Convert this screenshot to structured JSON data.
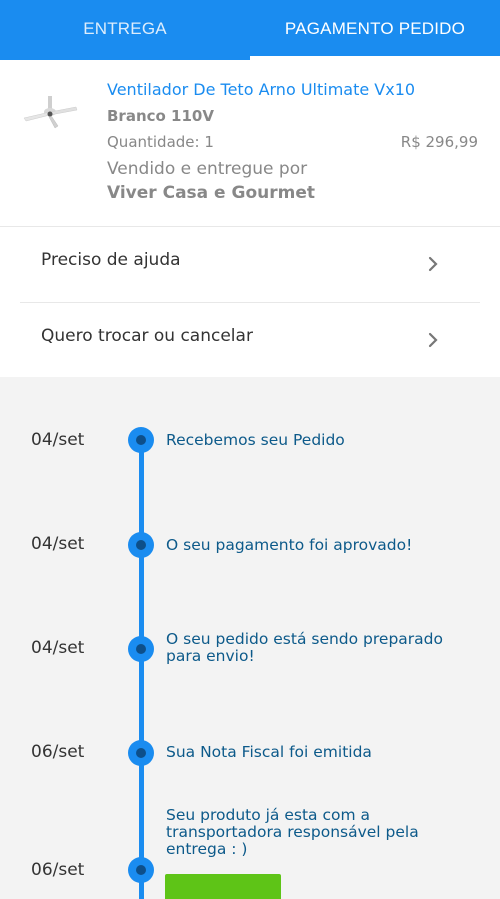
{
  "tabs": [
    {
      "label": "ENTREGA"
    },
    {
      "label": "PAGAMENTO PEDIDO"
    }
  ],
  "product": {
    "name": "Ventilador De Teto Arno Ultimate Vx10",
    "variant": "Branco 110V",
    "quantity": "Quantidade: 1",
    "price": "R$ 296,99",
    "sold_by": "Vendido e entregue por",
    "seller": "Viver Casa e Gourmet"
  },
  "menu": [
    {
      "label": "Preciso de ajuda"
    },
    {
      "label": "Quero trocar ou cancelar"
    }
  ],
  "timeline": [
    {
      "date": "04/set",
      "text": "Recebemos seu Pedido"
    },
    {
      "date": "04/set",
      "text": "O seu pagamento foi aprovado!"
    },
    {
      "date": "04/set",
      "text": "O seu pedido está sendo preparado para envio!"
    },
    {
      "date": "06/set",
      "text": "Sua Nota Fiscal foi emitida"
    },
    {
      "date": "06/set",
      "text": "Seu produto já esta com a transportadora responsável pela entrega : )"
    }
  ],
  "colors": {
    "accent": "#1a8cf0",
    "success": "#5ec417"
  }
}
